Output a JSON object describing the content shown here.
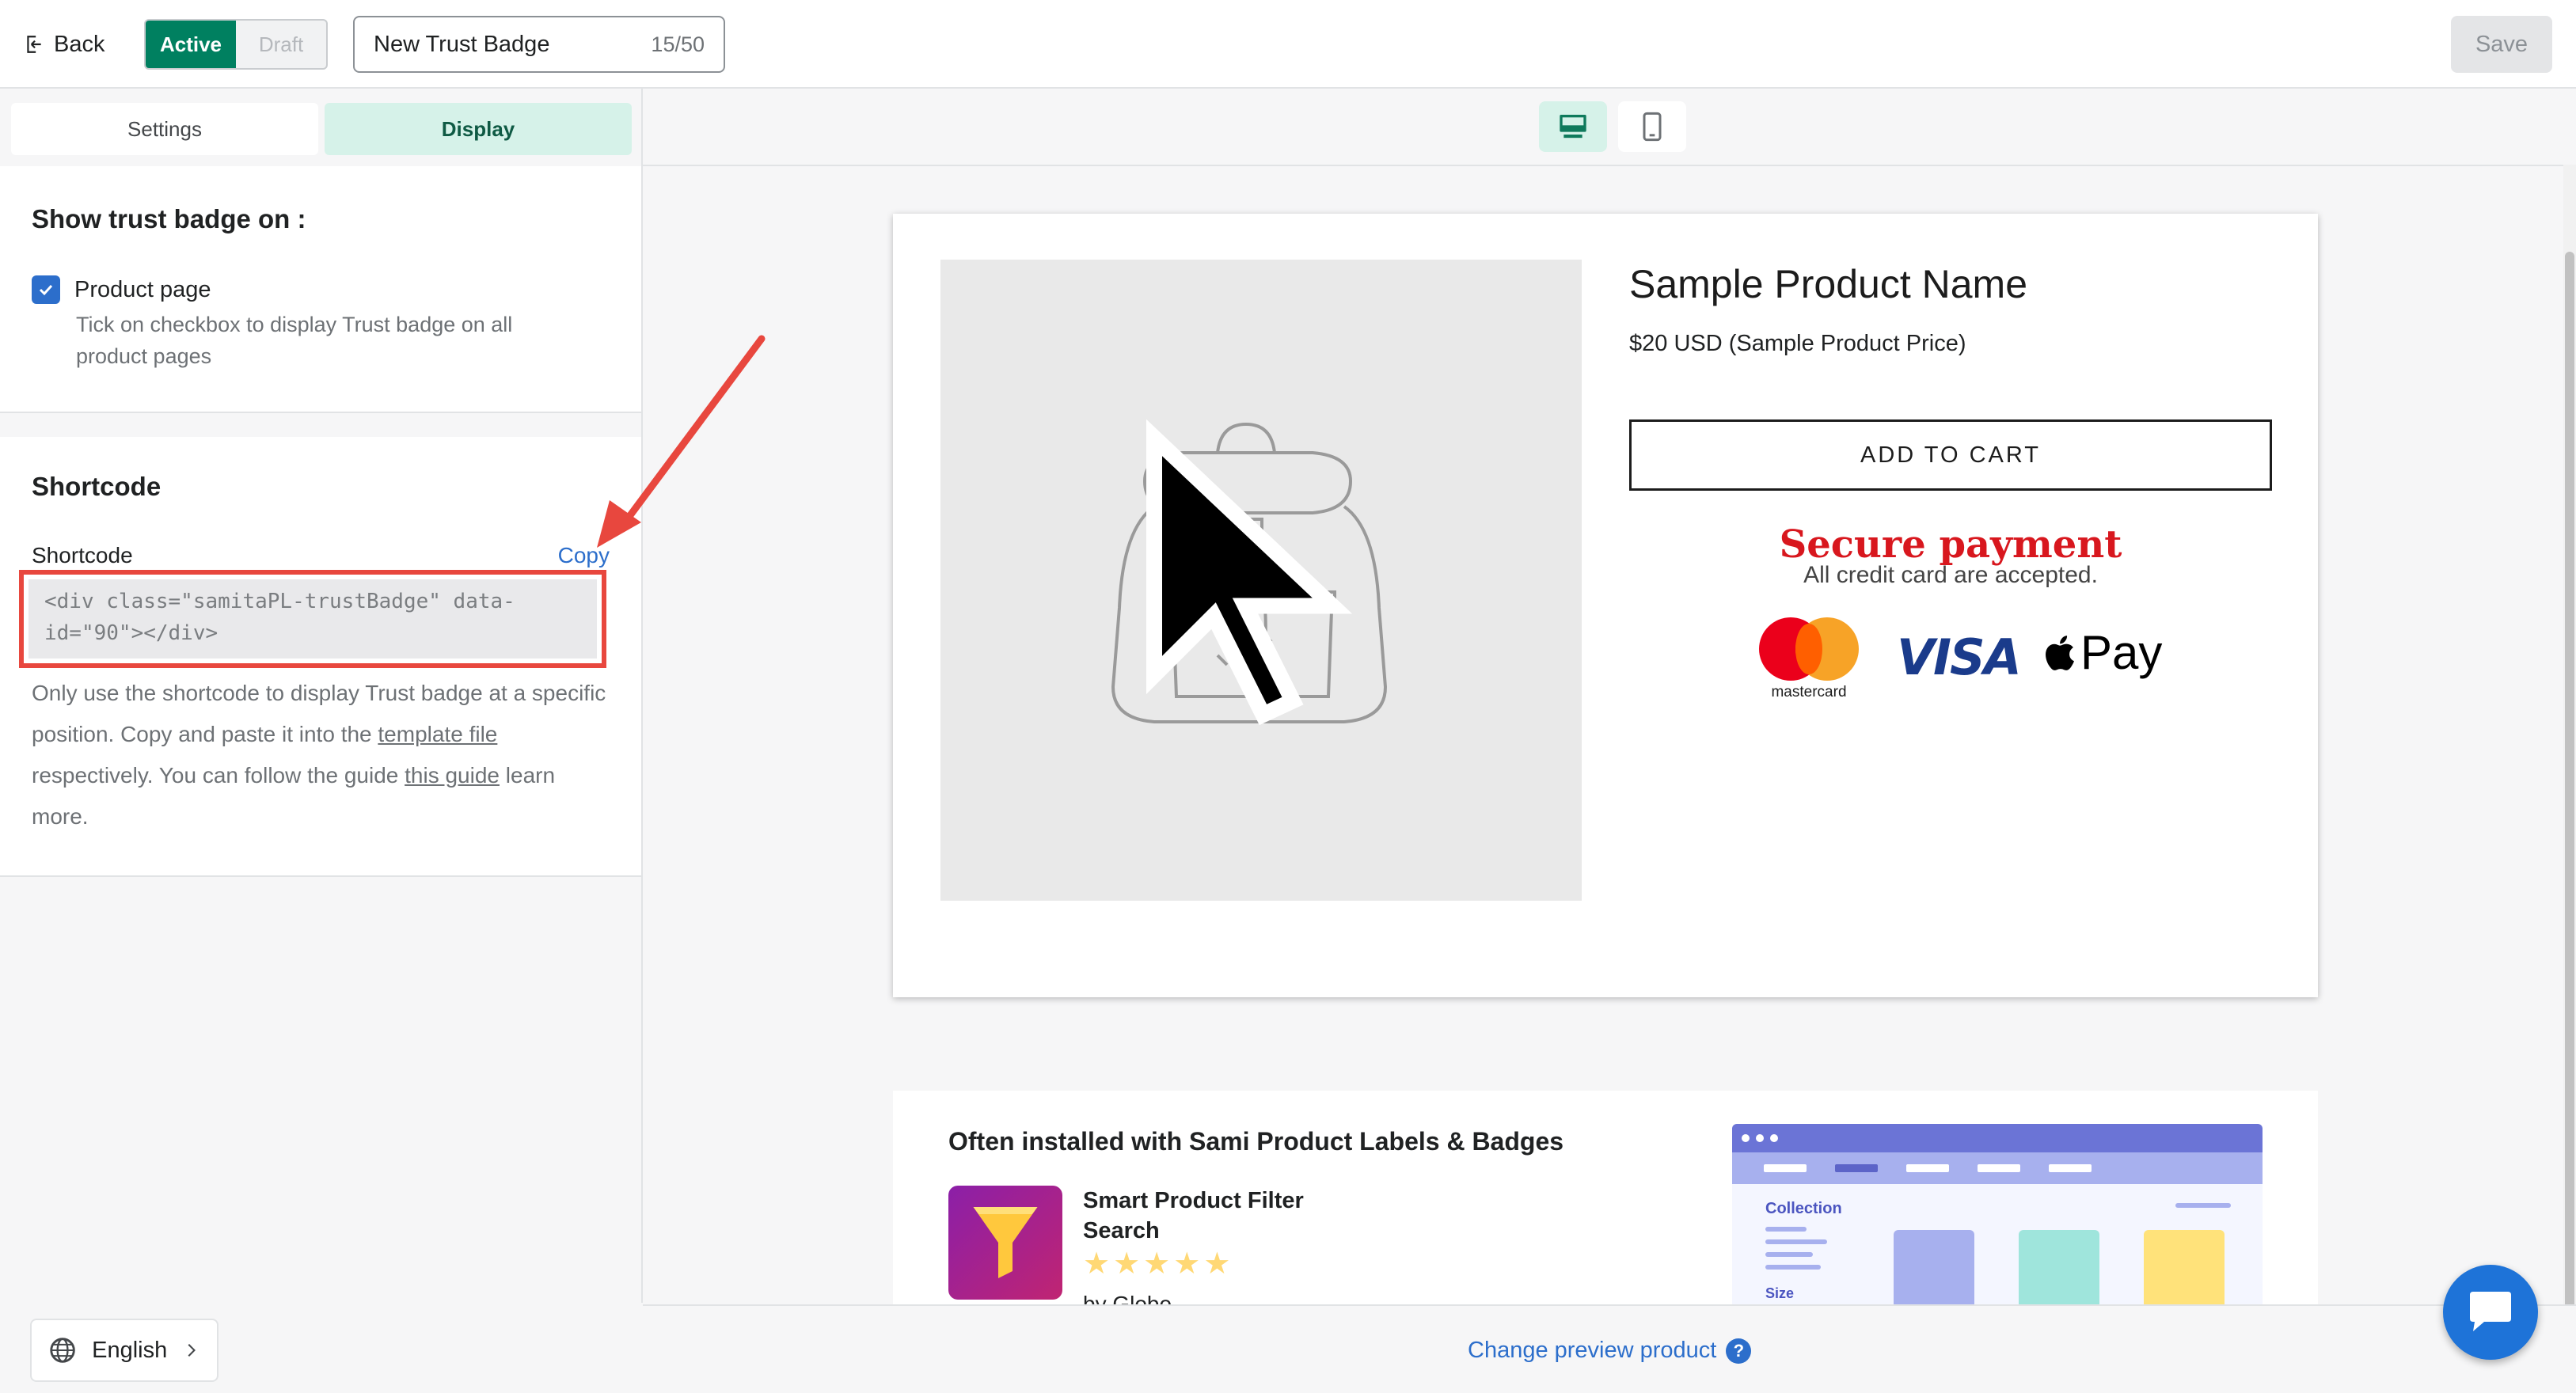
{
  "topbar": {
    "back_label": "Back",
    "status_active": "Active",
    "status_draft": "Draft",
    "badge_name": "New Trust Badge",
    "char_count": "15/50",
    "save_label": "Save"
  },
  "sidebar": {
    "tab_settings": "Settings",
    "tab_display": "Display",
    "show_on_title": "Show trust badge on :",
    "product_page_label": "Product page",
    "product_page_checked": true,
    "product_page_help": "Tick on checkbox to display Trust badge on all product pages",
    "shortcode_title": "Shortcode",
    "shortcode_label": "Shortcode",
    "copy_label": "Copy",
    "shortcode_value": "<div class=\"samitaPL-trustBadge\" data-id=\"90\"></div>",
    "help_part1": "Only use the shortcode to display Trust badge at a specific position. Copy and paste it into the ",
    "help_link1": "template file",
    "help_part2": " respectively. You can follow the guide ",
    "help_link2": "this guide",
    "help_part3": " learn more.",
    "language": "English"
  },
  "preview": {
    "device_desktop_icon": "desktop-icon",
    "device_mobile_icon": "mobile-icon",
    "product_name": "Sample Product Name",
    "product_price": "$20 USD (Sample Product Price)",
    "add_to_cart": "ADD TO CART",
    "secure_title": "Secure payment",
    "secure_subtitle": "All credit card are accepted.",
    "mastercard_label": "mastercard",
    "visa_label": "VISA",
    "applepay_label": "Pay",
    "upsell_title": "Often installed with Sami Product Labels & Badges",
    "app_name": "Smart Product Filter Search",
    "app_rating": 5,
    "app_by": "by Globo",
    "mini_collection": "Collection",
    "mini_size": "Size",
    "change_preview": "Change preview product",
    "help_mark": "?"
  },
  "colors": {
    "primary_green": "#008060",
    "link_blue": "#2c6ecb",
    "annotation_red": "#e8473e",
    "secure_red": "#d8171e"
  }
}
